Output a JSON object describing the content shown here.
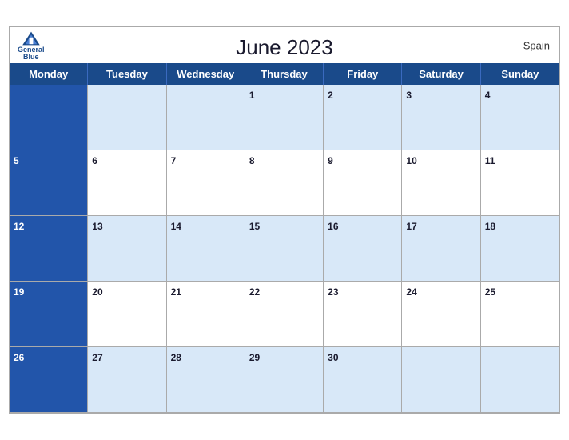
{
  "header": {
    "title": "June 2023",
    "country": "Spain",
    "logo_line1": "General",
    "logo_line2": "Blue"
  },
  "days": [
    "Monday",
    "Tuesday",
    "Wednesday",
    "Thursday",
    "Friday",
    "Saturday",
    "Sunday"
  ],
  "weeks": [
    [
      null,
      null,
      null,
      1,
      2,
      3,
      4
    ],
    [
      5,
      6,
      7,
      8,
      9,
      10,
      11
    ],
    [
      12,
      13,
      14,
      15,
      16,
      17,
      18
    ],
    [
      19,
      20,
      21,
      22,
      23,
      24,
      25
    ],
    [
      26,
      27,
      28,
      29,
      30,
      null,
      null
    ]
  ],
  "colors": {
    "header_bg": "#1a4a8a",
    "row_blue": "#d6e4f7",
    "row_white": "#ffffff",
    "row_label": "#1e55b0",
    "text_dark": "#1a1a2e",
    "border": "#aaaaaa"
  }
}
